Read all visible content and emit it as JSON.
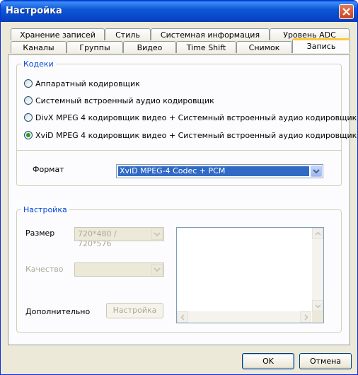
{
  "window": {
    "title": "Настройка",
    "close_icon": "close-icon"
  },
  "tabs_row1": [
    "Хранение записей",
    "Стиль",
    "Системная информация",
    "Уровень ADC"
  ],
  "tabs_row2": [
    "Каналы",
    "Группы",
    "Видео",
    "Time Shift",
    "Снимок",
    "Запись"
  ],
  "active_tab": "Запись",
  "codecs": {
    "legend": "Кодеки",
    "options": [
      "Аппаратный кодировщик",
      "Системный встроенный аудио кодировщик",
      "DivX MPEG 4  кодировщик видео + Системный встроенный аудио кодировщик",
      "XviD MPEG 4  кодировщик видео + Системный встроенный аудио кодировщик"
    ],
    "selected_index": 3,
    "format_label": "Формат",
    "format_value": "XviD MPEG-4 Codec + PCM"
  },
  "settings": {
    "legend": "Настройка",
    "size_label": "Размер",
    "size_value": "720*480 / 720*576",
    "quality_label": "Качество",
    "quality_value": "",
    "extra_label": "Дополнительно",
    "settings_button": "Настройка"
  },
  "footer": {
    "ok": "OK",
    "cancel": "Отмена"
  },
  "colors": {
    "accent": "#0046d5",
    "titlebar": "#0a5fde",
    "tab_highlight": "#ffc83c",
    "radio_dot": "#21a121"
  }
}
